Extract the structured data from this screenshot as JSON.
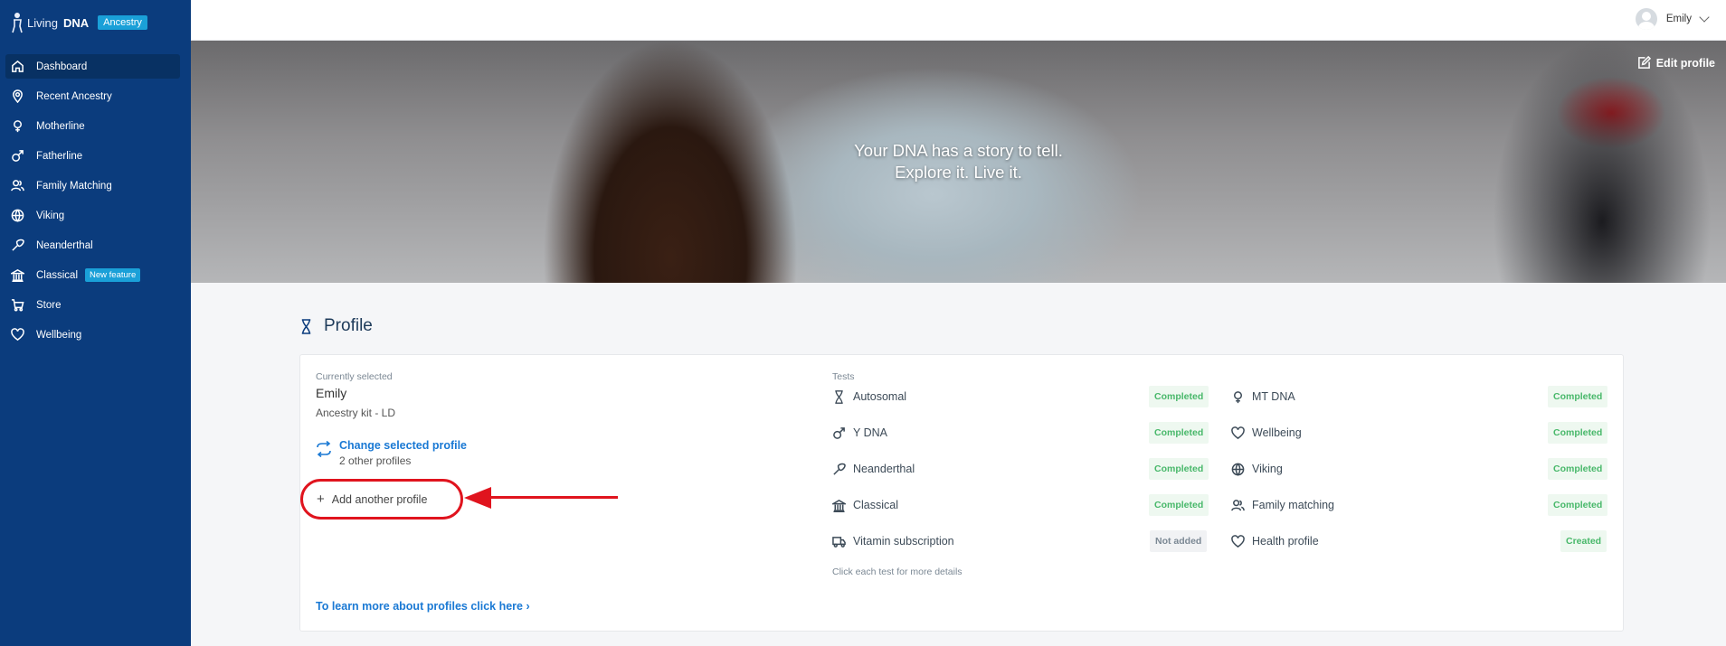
{
  "logo": {
    "living": "Living",
    "dna": "DNA",
    "badge": "Ancestry"
  },
  "nav": [
    {
      "label": "Dashboard",
      "icon": "home-icon",
      "active": true
    },
    {
      "label": "Recent Ancestry",
      "icon": "map-pin-icon"
    },
    {
      "label": "Motherline",
      "icon": "female-symbol-icon"
    },
    {
      "label": "Fatherline",
      "icon": "male-symbol-icon"
    },
    {
      "label": "Family Matching",
      "icon": "users-icon"
    },
    {
      "label": "Viking",
      "icon": "globe-icon"
    },
    {
      "label": "Neanderthal",
      "icon": "club-icon"
    },
    {
      "label": "Classical",
      "icon": "temple-icon",
      "badge": "New feature"
    },
    {
      "label": "Store",
      "icon": "cart-icon"
    },
    {
      "label": "Wellbeing",
      "icon": "heart-icon"
    }
  ],
  "user": {
    "name": "Emily"
  },
  "hero": {
    "line1": "Your DNA has a story to tell.",
    "line2": "Explore it. Live it.",
    "edit_label": "Edit profile"
  },
  "profile": {
    "heading": "Profile",
    "currently_selected_label": "Currently selected",
    "name": "Emily",
    "kit": "Ancestry kit - LD",
    "change_label": "Change selected profile",
    "other_profiles": "2 other profiles",
    "add_label": "Add another profile",
    "learn_more": "To learn more about profiles click here",
    "learn_more_chevron": "›"
  },
  "tests": {
    "label": "Tests",
    "left": [
      {
        "name": "Autosomal",
        "icon": "dna-icon",
        "status": "Completed"
      },
      {
        "name": "Y DNA",
        "icon": "male-symbol-icon",
        "status": "Completed"
      },
      {
        "name": "Neanderthal",
        "icon": "club-icon",
        "status": "Completed"
      },
      {
        "name": "Classical",
        "icon": "temple-icon",
        "status": "Completed"
      },
      {
        "name": "Vitamin subscription",
        "icon": "truck-icon",
        "status": "Not added"
      }
    ],
    "right": [
      {
        "name": "MT DNA",
        "icon": "female-symbol-icon",
        "status": "Completed"
      },
      {
        "name": "Wellbeing",
        "icon": "heart-icon",
        "status": "Completed"
      },
      {
        "name": "Viking",
        "icon": "globe-icon",
        "status": "Completed"
      },
      {
        "name": "Family matching",
        "icon": "users-icon",
        "status": "Completed"
      },
      {
        "name": "Health profile",
        "icon": "heart-icon",
        "status": "Created"
      }
    ],
    "note": "Click each test for more details"
  },
  "colors": {
    "sidebar": "#0b3c7d",
    "accent": "#1aa0d8",
    "link": "#1a79d4",
    "success": "#48b86a",
    "annotation": "#e0141e"
  }
}
